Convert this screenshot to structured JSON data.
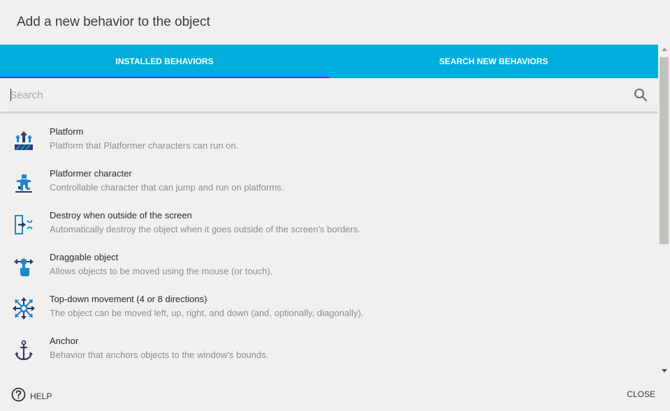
{
  "dialog": {
    "title": "Add a new behavior to the object"
  },
  "tabs": [
    {
      "label": "INSTALLED BEHAVIORS",
      "active": true
    },
    {
      "label": "SEARCH NEW BEHAVIORS",
      "active": false
    }
  ],
  "search": {
    "placeholder": "Search",
    "value": "",
    "icon": "search-icon"
  },
  "behaviors": [
    {
      "name": "Platform",
      "description": "Platform that Platformer characters can run on.",
      "icon": "platform-icon"
    },
    {
      "name": "Platformer character",
      "description": "Controllable character that can jump and run on platforms.",
      "icon": "platformer-character-icon"
    },
    {
      "name": "Destroy when outside of the screen",
      "description": "Automatically destroy the object when it goes outside of the screen's borders.",
      "icon": "destroy-outside-icon"
    },
    {
      "name": "Draggable object",
      "description": "Allows objects to be moved using the mouse (or touch).",
      "icon": "draggable-icon"
    },
    {
      "name": "Top-down movement (4 or 8 directions)",
      "description": "The object can be moved left, up, right, and down (and, optionally, diagonally).",
      "icon": "top-down-movement-icon"
    },
    {
      "name": "Anchor",
      "description": "Behavior that anchors objects to the window's bounds.",
      "icon": "anchor-icon"
    }
  ],
  "footer": {
    "help_label": "HELP",
    "close_label": "CLOSE"
  },
  "colors": {
    "tab_bar": "#00aedb",
    "tab_indicator": "#9012fe",
    "background": "#f1f0ef",
    "icon_blue": "#1e88c8",
    "icon_dark": "#2c3a6b"
  }
}
